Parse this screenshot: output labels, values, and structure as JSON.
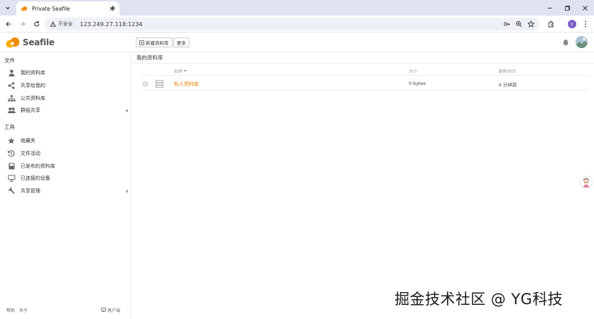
{
  "browser": {
    "tab_title": "Private Seafile",
    "security_label": "不安全",
    "url": "123.249.27.118:1234",
    "profile_initial": "c"
  },
  "header": {
    "logo_text": "Seafile",
    "new_library_label": "新建资料库",
    "more_label": "更多"
  },
  "sidebar": {
    "files_heading": "文件",
    "files_items": [
      {
        "label": "我的资料库",
        "icon": "user-icon"
      },
      {
        "label": "共享给我的",
        "icon": "share-icon"
      },
      {
        "label": "公共资料库",
        "icon": "org-icon"
      },
      {
        "label": "群组共享",
        "icon": "group-icon",
        "expandable": true
      }
    ],
    "tools_heading": "工具",
    "tools_items": [
      {
        "label": "收藏夹",
        "icon": "star-icon"
      },
      {
        "label": "文件活动",
        "icon": "history-icon"
      },
      {
        "label": "已发布的资料库",
        "icon": "book-icon"
      },
      {
        "label": "已连接的设备",
        "icon": "monitor-icon"
      },
      {
        "label": "共享管理",
        "icon": "wrench-icon",
        "expandable": true
      }
    ],
    "footer": {
      "help": "帮助",
      "about": "关于",
      "client": "客户端"
    }
  },
  "main": {
    "title": "我的资料库",
    "columns": {
      "name": "名称",
      "size": "大小",
      "updated": "更新时间"
    },
    "rows": [
      {
        "name": "私人资料库",
        "size": "0 bytes",
        "updated": "4 分钟前"
      }
    ]
  },
  "watermark": "掘金技术社区 @ YG科技",
  "colors": {
    "accent": "#eb8205",
    "tabbar": "#dee3ef",
    "omnibox": "#eef1f8"
  }
}
